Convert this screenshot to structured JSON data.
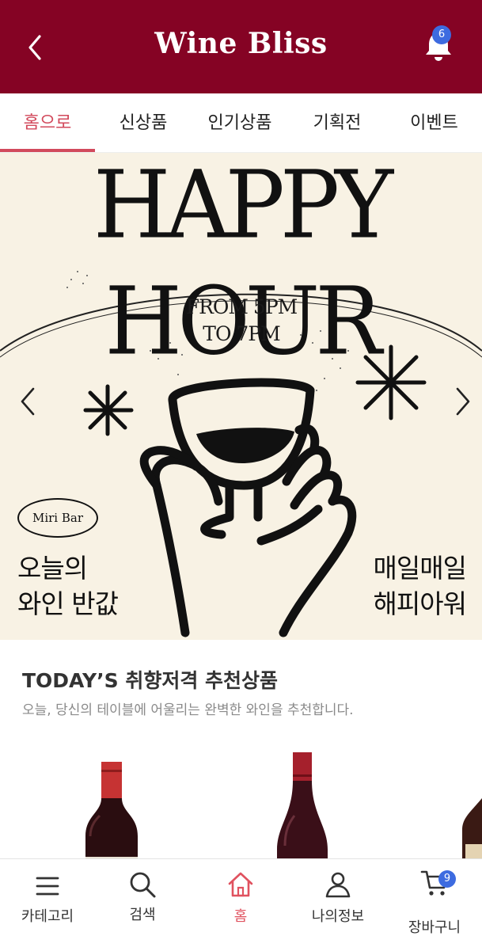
{
  "header": {
    "title": "Wine Bliss",
    "back_icon": "chevron-left-icon",
    "notification_icon": "bell-icon",
    "notification_count": "6",
    "background_color": "#850324"
  },
  "tabs": [
    {
      "label": "홈으로",
      "active": true
    },
    {
      "label": "신상품",
      "active": false
    },
    {
      "label": "인기상품",
      "active": false
    },
    {
      "label": "기획전",
      "active": false
    },
    {
      "label": "이벤트",
      "active": false
    }
  ],
  "accent_color": "#d24a5c",
  "banner": {
    "headline": "HAPPY HOUR",
    "time_line1": "FROM 5PM",
    "time_line2": "TO 7PM",
    "logo": "Miri Bar",
    "left_copy": "오늘의\n와인 반값",
    "right_copy": "매일매일\n해피아워",
    "background_color": "#f8f2e4"
  },
  "recommend": {
    "title": "TODAY’S 취향저격 추천상품",
    "subtitle": "오늘, 당신의 테이블에 어울리는 완벽한 와인을 추천합니다."
  },
  "bottom_nav": [
    {
      "label": "카테고리",
      "icon": "menu-icon",
      "active": false
    },
    {
      "label": "검색",
      "icon": "search-icon",
      "active": false
    },
    {
      "label": "홈",
      "icon": "home-icon",
      "active": true
    },
    {
      "label": "나의정보",
      "icon": "user-icon",
      "active": false
    },
    {
      "label": "장바구니",
      "icon": "cart-icon",
      "active": false,
      "badge": "9"
    }
  ]
}
